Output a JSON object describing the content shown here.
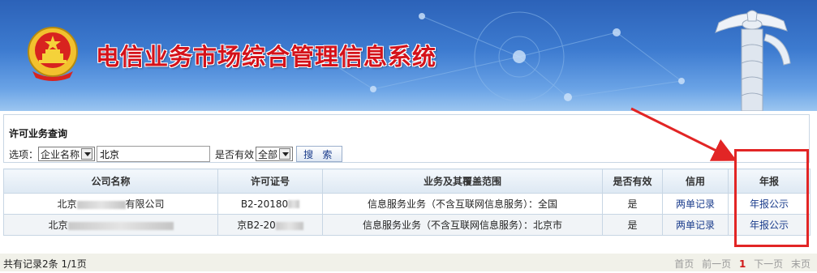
{
  "header": {
    "title": "电信业务市场综合管理信息系统"
  },
  "query": {
    "title": "许可业务查询",
    "option_label": "选项：",
    "field_select": "企业名称",
    "search_value": "北京",
    "valid_label": "是否有效",
    "valid_select": "全部",
    "search_button": "搜 索"
  },
  "table": {
    "headers": [
      "公司名称",
      "许可证号",
      "业务及其覆盖范围",
      "是否有效",
      "信用",
      "年报"
    ],
    "rows": [
      {
        "company_visible": "北京",
        "company_tail": "有限公司",
        "license": "B2-20180",
        "scope": "信息服务业务（不含互联网信息服务）：全国",
        "valid": "是",
        "credit": "两单记录",
        "report": "年报公示"
      },
      {
        "company_visible": "北京",
        "company_tail": "",
        "license": "京B2-20",
        "scope": "信息服务业务（不含互联网信息服务）：北京市",
        "valid": "是",
        "credit": "两单记录",
        "report": "年报公示"
      }
    ]
  },
  "pagination": {
    "summary": "共有记录2条 1/1页",
    "first": "首页",
    "prev": "前一页",
    "current": "1",
    "next": "下一页",
    "last": "末页"
  },
  "colors": {
    "banner": "#3d7bd0",
    "title_red": "#d4121a",
    "annotation_red": "#e22525",
    "link": "#1a3c8c"
  }
}
